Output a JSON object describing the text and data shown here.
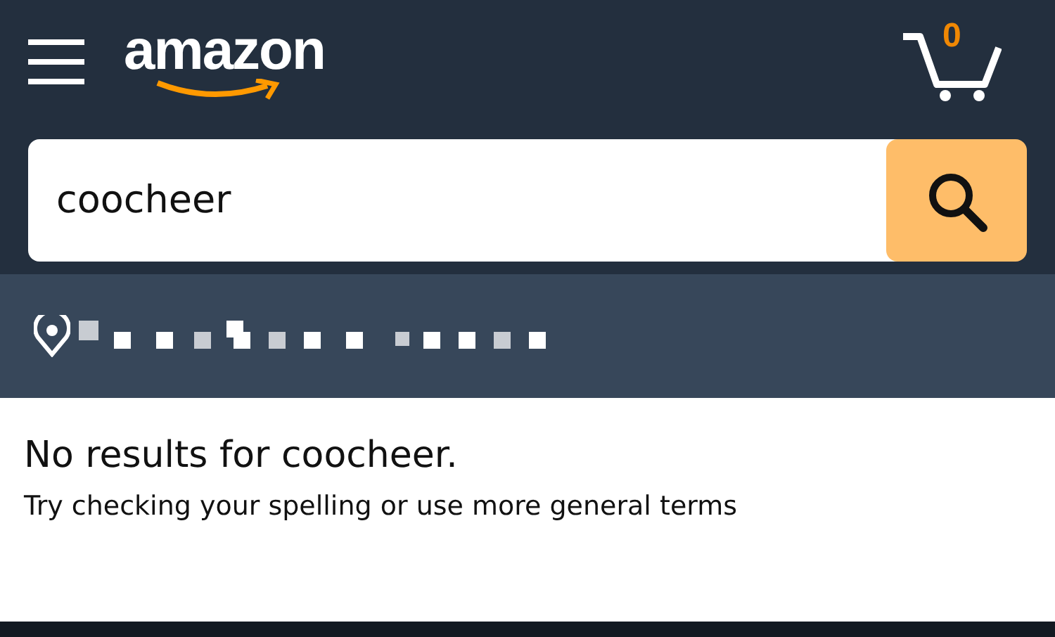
{
  "header": {
    "logo": "amazon",
    "cart_count": "0"
  },
  "search": {
    "value": "coocheer"
  },
  "results": {
    "title": "No results for coocheer.",
    "hint": "Try checking your spelling or use more general terms"
  }
}
